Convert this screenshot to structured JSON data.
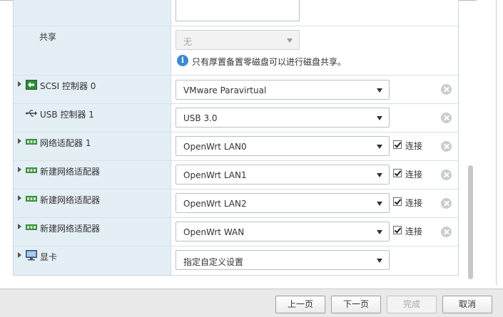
{
  "rows": {
    "sharing": {
      "label": "共享",
      "value": "无",
      "info": "只有厚置备置零磁盘可以进行磁盘共享。"
    },
    "scsi": {
      "label": "SCSI 控制器 0",
      "value": "VMware Paravirtual"
    },
    "usb": {
      "label": "USB 控制器 1",
      "value": "USB 3.0"
    },
    "net1": {
      "label": "网络适配器 1",
      "value": "OpenWrt LAN0",
      "connect": "连接"
    },
    "net2": {
      "label": "新建网络适配器",
      "value": "OpenWrt LAN1",
      "connect": "连接"
    },
    "net3": {
      "label": "新建网络适配器",
      "value": "OpenWrt LAN2",
      "connect": "连接"
    },
    "net4": {
      "label": "新建网络适配器",
      "value": "OpenWrt WAN",
      "connect": "连接"
    },
    "video": {
      "label": "显卡",
      "value": "指定自定义设置"
    }
  },
  "footer": {
    "prev": "上一页",
    "next": "下一页",
    "finish": "完成",
    "cancel": "取消"
  },
  "colors": {
    "label_bg": "#e4eef5",
    "info_icon": "#3d8ad1",
    "nic_icon": "#3a8f3a"
  }
}
